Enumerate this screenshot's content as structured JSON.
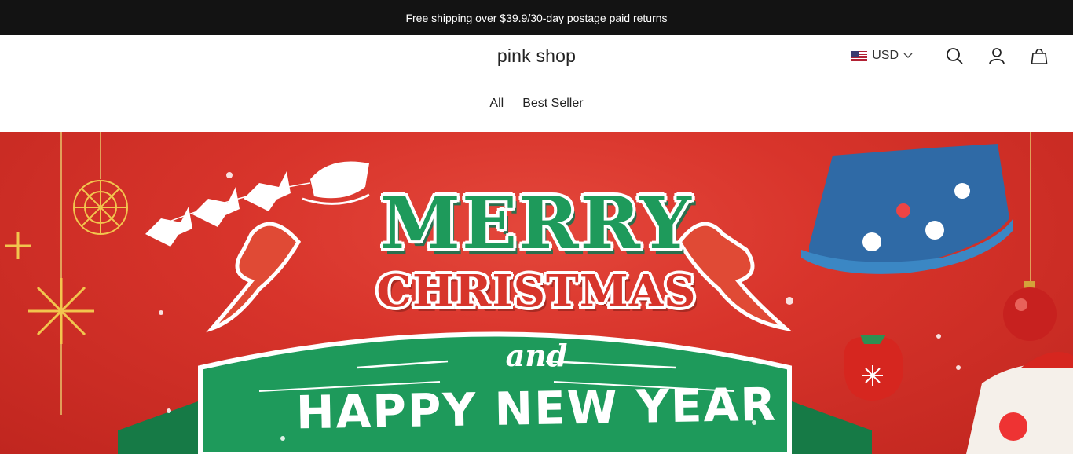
{
  "announcement": "Free shipping over $39.9/30-day postage paid returns",
  "header": {
    "logo": "pink shop",
    "currency": "USD"
  },
  "nav": {
    "items": [
      "All",
      "Best Seller"
    ]
  },
  "banner": {
    "line1": "MERRY",
    "line2": "CHRISTMAS",
    "line3": "and",
    "line4": "HAPPY NEW YEAR"
  },
  "icons": {
    "flag": "us-flag-icon",
    "chevron": "chevron-down-icon",
    "search": "search-icon",
    "account": "user-icon",
    "cart": "bag-icon"
  },
  "colors": {
    "topbar": "#131313",
    "banner_red": "#d8342b",
    "banner_green": "#1e9a5b"
  }
}
